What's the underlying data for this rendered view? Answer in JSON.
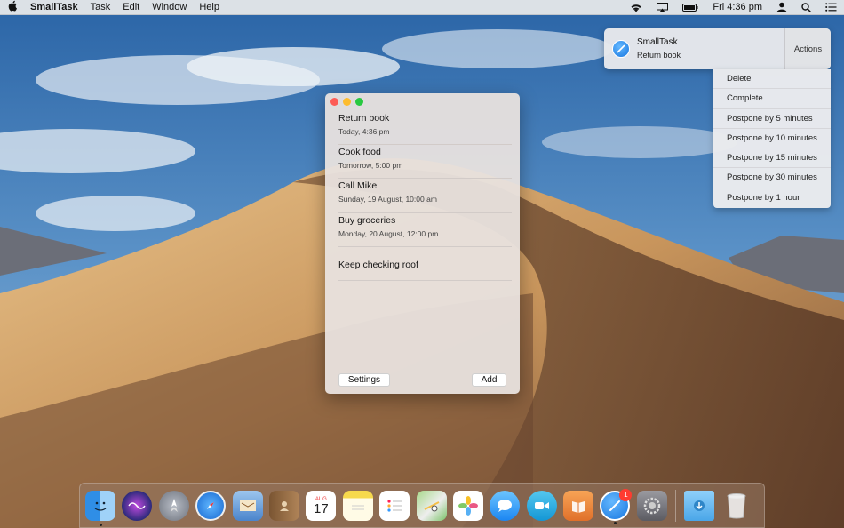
{
  "menubar": {
    "app_name": "SmallTask",
    "menus": [
      "Task",
      "Edit",
      "Window",
      "Help"
    ],
    "clock": "Fri 4:36 pm",
    "status_icons": [
      "wifi-icon",
      "airplay-icon",
      "battery-icon",
      "user-icon",
      "spotlight-icon",
      "notification-center-icon"
    ]
  },
  "notification": {
    "title": "SmallTask",
    "body": "Return book",
    "actions_label": "Actions"
  },
  "actions_menu": {
    "items": [
      "Delete",
      "Complete",
      "Postpone by 5 minutes",
      "Postpone by 10 minutes",
      "Postpone by 15 minutes",
      "Postpone by 30 minutes",
      "Postpone by 1 hour"
    ]
  },
  "window": {
    "tasks": [
      {
        "title": "Return book",
        "date": "Today, 4:36 pm"
      },
      {
        "title": "Cook food",
        "date": "Tomorrow, 5:00 pm"
      },
      {
        "title": "Call Mike",
        "date": "Sunday, 19 August, 10:00 am"
      },
      {
        "title": "Buy groceries",
        "date": "Monday, 20 August, 12:00 pm"
      },
      {
        "title": "Keep checking roof",
        "date": ""
      }
    ],
    "settings_label": "Settings",
    "add_label": "Add"
  },
  "dock": {
    "calendar_month": "AUG",
    "calendar_day": "17",
    "smalltask_badge": "1",
    "colors": {
      "finder": "#3a9be8",
      "siri": "#5a3cc4",
      "launchpad": "#8a8f99",
      "safari": "#2d8ff0",
      "mail": "#4a8ad8",
      "contacts": "#a67c52",
      "calendar": "#ffffff",
      "notes": "#f7d94c",
      "reminders": "#ffffff",
      "maps": "#7cc36a",
      "photos": "#ffffff",
      "messages": "#3aa3f5",
      "facetime": "#2fb0e8",
      "ibooks": "#f08b3c",
      "smalltask": "#2a8df0",
      "preferences": "#8a8a8e",
      "downloads": "#5db6f2",
      "trash": "#dcdcdc"
    }
  }
}
